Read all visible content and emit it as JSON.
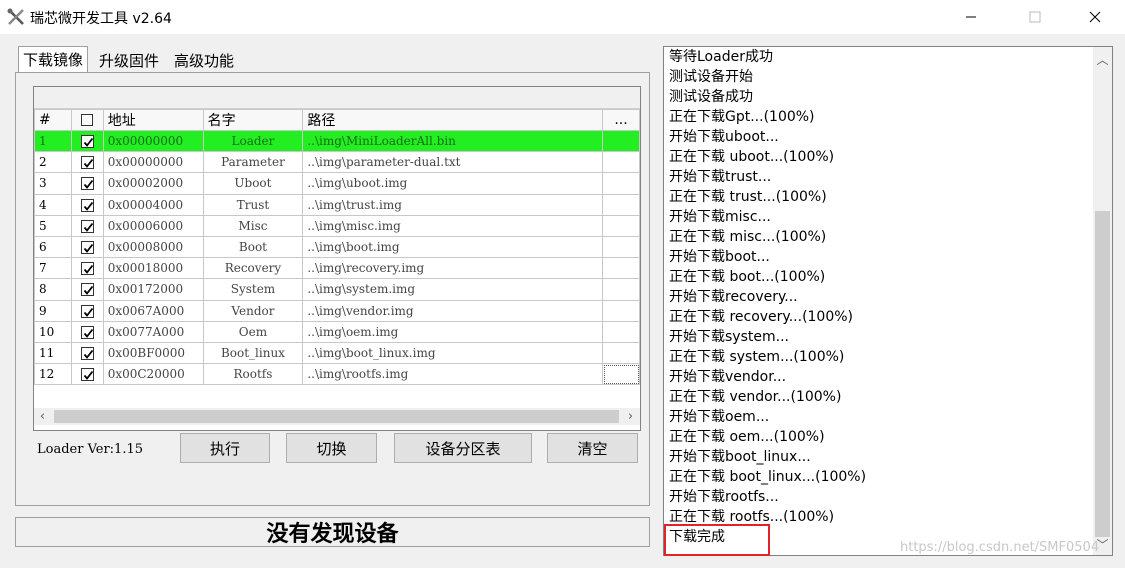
{
  "window": {
    "title": "瑞芯微开发工具 v2.64",
    "icon": "tools-icon"
  },
  "tabs": [
    {
      "label": "下载镜像",
      "active": true
    },
    {
      "label": "升级固件",
      "active": false
    },
    {
      "label": "高级功能",
      "active": false
    }
  ],
  "table": {
    "headers": {
      "num": "#",
      "check": "☐",
      "addr": "地址",
      "name": "名字",
      "path": "路径",
      "more": "..."
    },
    "rows": [
      {
        "num": "1",
        "checked": true,
        "addr": "0x00000000",
        "name": "Loader",
        "path": "..\\img\\MiniLoaderAll.bin",
        "highlighted": true
      },
      {
        "num": "2",
        "checked": true,
        "addr": "0x00000000",
        "name": "Parameter",
        "path": "..\\img\\parameter-dual.txt"
      },
      {
        "num": "3",
        "checked": true,
        "addr": "0x00002000",
        "name": "Uboot",
        "path": "..\\img\\uboot.img"
      },
      {
        "num": "4",
        "checked": true,
        "addr": "0x00004000",
        "name": "Trust",
        "path": "..\\img\\trust.img"
      },
      {
        "num": "5",
        "checked": true,
        "addr": "0x00006000",
        "name": "Misc",
        "path": "..\\img\\misc.img"
      },
      {
        "num": "6",
        "checked": true,
        "addr": "0x00008000",
        "name": "Boot",
        "path": "..\\img\\boot.img"
      },
      {
        "num": "7",
        "checked": true,
        "addr": "0x00018000",
        "name": "Recovery",
        "path": "..\\img\\recovery.img"
      },
      {
        "num": "8",
        "checked": true,
        "addr": "0x00172000",
        "name": "System",
        "path": "..\\img\\system.img"
      },
      {
        "num": "9",
        "checked": true,
        "addr": "0x0067A000",
        "name": "Vendor",
        "path": "..\\img\\vendor.img"
      },
      {
        "num": "10",
        "checked": true,
        "addr": "0x0077A000",
        "name": "Oem",
        "path": "..\\img\\oem.img"
      },
      {
        "num": "11",
        "checked": true,
        "addr": "0x00BF0000",
        "name": "Boot_linux",
        "path": "..\\img\\boot_linux.img"
      },
      {
        "num": "12",
        "checked": true,
        "addr": "0x00C20000",
        "name": "Rootfs",
        "path": "..\\img\\rootfs.img"
      }
    ]
  },
  "loader_version": "Loader Ver:1.15",
  "buttons": {
    "execute": "执行",
    "switch": "切换",
    "partition_table": "设备分区表",
    "clear": "清空"
  },
  "status_text": "没有发现设备",
  "log": [
    "等待Loader成功",
    "测试设备开始",
    "测试设备成功",
    "正在下载Gpt...(100%)",
    "开始下载uboot...",
    "正在下载 uboot...(100%)",
    "开始下载trust...",
    "正在下载 trust...(100%)",
    "开始下载misc...",
    "正在下载 misc...(100%)",
    "开始下载boot...",
    "正在下载 boot...(100%)",
    "开始下载recovery...",
    "正在下载 recovery...(100%)",
    "开始下载system...",
    "正在下载 system...(100%)",
    "开始下载vendor...",
    "正在下载 vendor...(100%)",
    "开始下载oem...",
    "正在下载 oem...(100%)",
    "开始下载boot_linux...",
    "正在下载 boot_linux...(100%)",
    "开始下载rootfs...",
    "正在下载 rootfs...(100%)",
    "下载完成"
  ],
  "watermark": "https://blog.csdn.net/SMF0504",
  "colors": {
    "highlight_row": "#22ee22",
    "annotation_box": "#e0242a"
  }
}
